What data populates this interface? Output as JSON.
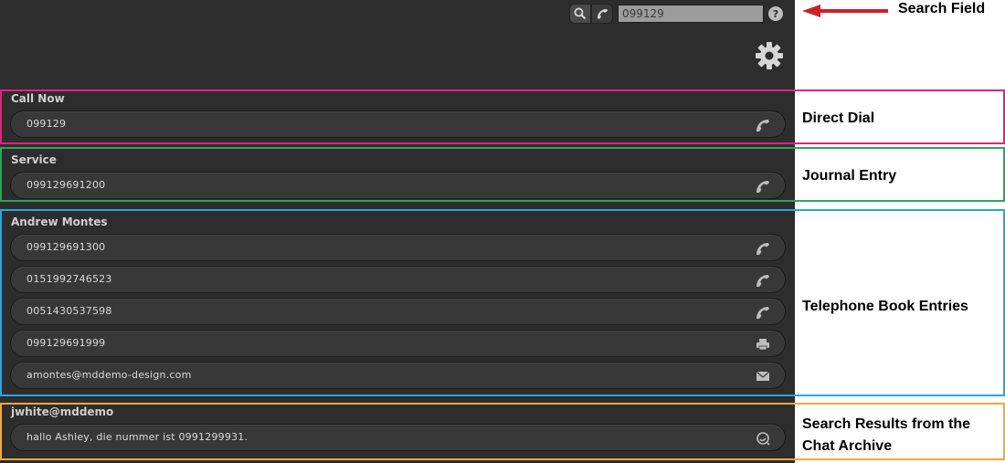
{
  "search": {
    "value": "099129",
    "annotation": "Search Field"
  },
  "groups": [
    {
      "title": "Call Now",
      "annotation": "Direct Dial",
      "color": "#e0247d",
      "rows": [
        {
          "text": "099129",
          "icon": "phone-icon"
        }
      ]
    },
    {
      "title": "Service",
      "annotation": "Journal Entry",
      "color": "#2ea55c",
      "rows": [
        {
          "text": "099129691200",
          "icon": "phone-icon"
        }
      ]
    },
    {
      "title": "Andrew Montes",
      "annotation": "Telephone Book Entries",
      "color": "#2aa6dc",
      "rows": [
        {
          "text": "099129691300",
          "icon": "phone-icon"
        },
        {
          "text": "0151992746523",
          "icon": "phone-icon"
        },
        {
          "text": "0051430537598",
          "icon": "phone-icon"
        },
        {
          "text": "099129691999",
          "icon": "fax-icon"
        },
        {
          "text": "amontes@mddemo-design.com",
          "icon": "mail-icon"
        }
      ]
    },
    {
      "title": "jwhite@mddemo",
      "annotation_line1": "Search Results from the",
      "annotation_line2": "Chat Archive",
      "color": "#f2a93b",
      "rows": [
        {
          "text": "hallo Ashley, die nummer ist 0991299931.",
          "icon": "chat-icon"
        }
      ]
    }
  ],
  "arrow_color": "#d0202a"
}
